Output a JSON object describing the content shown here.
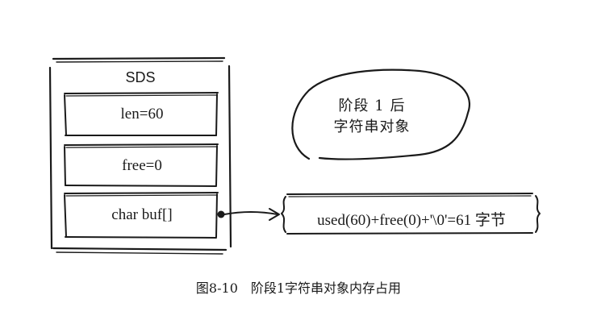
{
  "sds": {
    "title": "SDS",
    "fields": [
      {
        "label": "len=60"
      },
      {
        "label": "free=0"
      },
      {
        "label": "char buf[]"
      }
    ]
  },
  "bubble": {
    "line1": "阶段 1 后",
    "line2": "字符串对象"
  },
  "buffer": {
    "content": "used(60)+free(0)+'\\0'=61 字节"
  },
  "caption": "图8-10　阶段1字符串对象内存占用"
}
